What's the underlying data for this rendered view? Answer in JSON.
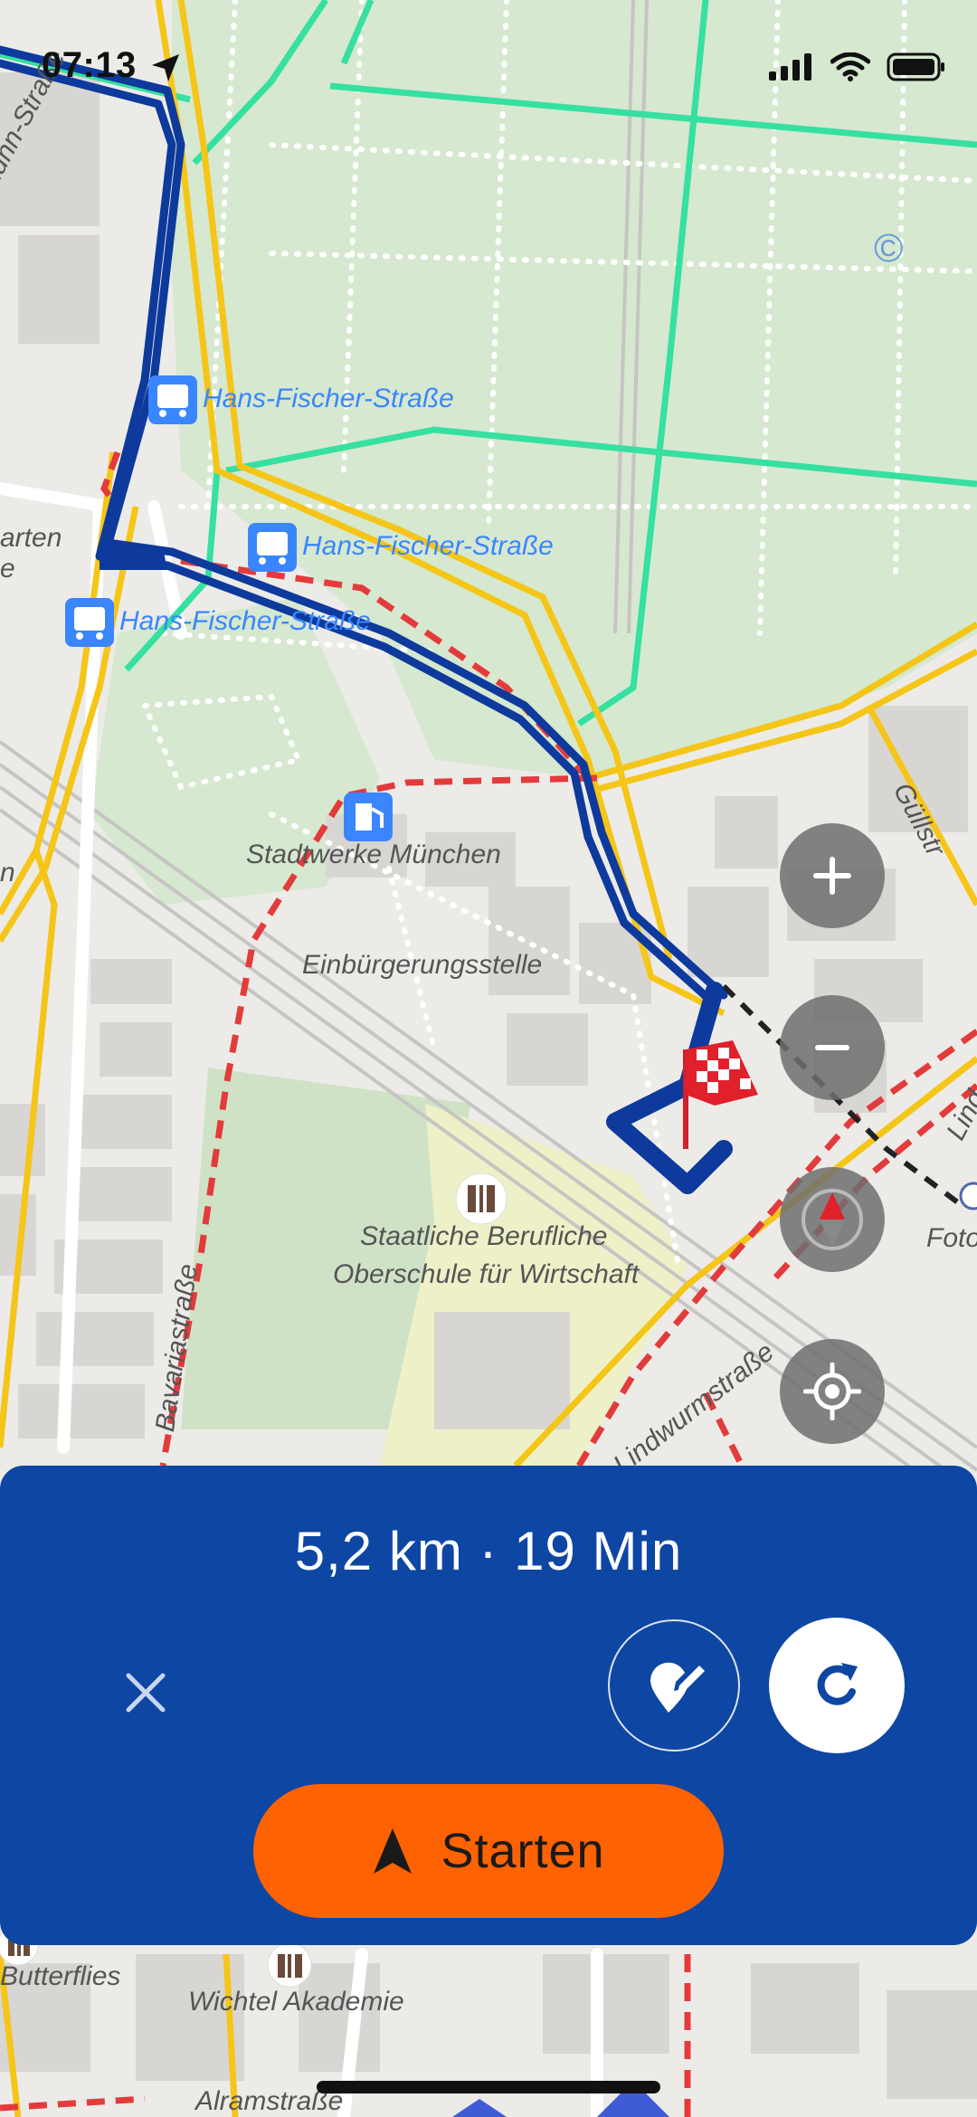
{
  "status_bar": {
    "time": "07:13",
    "icons": [
      "location-arrow-icon",
      "cellular-signal-icon",
      "wifi-icon",
      "battery-icon"
    ]
  },
  "map": {
    "copyright_symbol": "©",
    "bus_stops": [
      {
        "name": "Hans-Fischer-Straße"
      },
      {
        "name": "Hans-Fischer-Straße"
      },
      {
        "name": "Hans-Fischer-Straße"
      }
    ],
    "poi_labels": {
      "stadtwerke": "Stadtwerke München",
      "einbuergerung": "Einbürgerungsstelle",
      "schule_line1": "Staatliche Berufliche",
      "schule_line2": "Oberschule für Wirtschaft",
      "butterflies": "Butterflies",
      "wichtel": "Wichtel Akademie",
      "foto": "Foto"
    },
    "street_labels": {
      "kuehn": "Kühn-Straße",
      "garten": "arten",
      "gullstr": "Güllstr",
      "bavaria": "Bavariastraße",
      "lindwurm": "Lindwurmstraße",
      "lindw_right": "Lind",
      "alram": "Alramstraße",
      "n_left": "n",
      "e_left": "e"
    },
    "controls": {
      "zoom_in_icon": "plus-icon",
      "zoom_out_icon": "minus-icon",
      "compass_icon": "compass-icon",
      "locate_icon": "locate-me-icon"
    },
    "colors": {
      "route": "#0d3a9c",
      "main_road": "#f5c518",
      "tram": "#35e0a1",
      "footpath_red": "#e33b3b",
      "park": "#d6e8cf"
    }
  },
  "route_panel": {
    "summary": "5,2 km · 19 Min",
    "close_icon": "close-icon",
    "edit_icon": "edit-waypoint-icon",
    "refresh_icon": "refresh-icon",
    "start_button": {
      "icon": "navigation-arrow-icon",
      "label": "Starten",
      "color": "#ff6200"
    },
    "background_color": "#0e46a3"
  }
}
